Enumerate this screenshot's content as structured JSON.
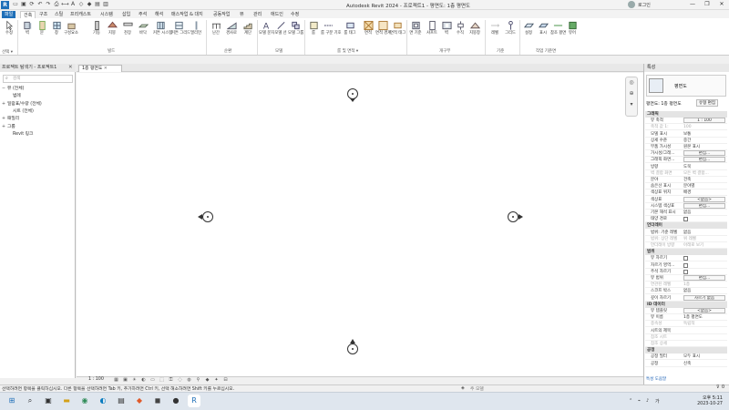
{
  "window": {
    "app_icon": "R",
    "title": "Autodesk Revit 2024 - 프로젝트1 - 평면도: 1층 평면도",
    "search_placeholder": "",
    "sign_in": "로그인",
    "controls": [
      "—",
      "❐",
      "✕"
    ]
  },
  "ribbon": {
    "tabs": [
      "파일",
      "건축",
      "구조",
      "스틸",
      "프리캐스트",
      "시스템",
      "삽입",
      "주석",
      "해석",
      "매스작업 & 대지",
      "공동작업",
      "뷰",
      "관리",
      "애드인",
      "수정"
    ],
    "active_tab": "건축",
    "modify_tool": "수정",
    "select_label": "선택 ▾",
    "groups": {
      "build": "빌드",
      "circulation": "순환",
      "model": "모델",
      "room_area": "룸 및 면적 ▾",
      "opening": "개구부",
      "datum": "기준",
      "work_plane": "작업 기준면"
    },
    "build_tools": [
      "벽",
      "문",
      "창",
      "구성요소",
      "기둥",
      "지붕",
      "천장",
      "바닥",
      "커튼 시스템",
      "커튼 그리드",
      "멀리언"
    ],
    "circulation_tools": [
      "난간",
      "경사로",
      "계단"
    ],
    "model_tools": [
      "모델 문자",
      "모델 선",
      "모델 그룹"
    ],
    "room_tools": [
      "룸",
      "룸 구분 기호",
      "룸 태그",
      "면적",
      "면적 경계",
      "면적 태그"
    ],
    "opening_tools": [
      "면 기준",
      "샤프트",
      "벽",
      "수직",
      "지붕창"
    ],
    "datum_tools": [
      "레벨",
      "그리드"
    ],
    "workplane_tools": [
      "설정",
      "표시",
      "참조 평면",
      "뷰어"
    ]
  },
  "project_browser": {
    "title": "프로젝트 탐색기 - 프로젝트1",
    "search_placeholder": "검색",
    "tree": [
      {
        "toggle": "−",
        "label": "뷰 (전체)",
        "indent": 0
      },
      {
        "toggle": "",
        "label": "범례",
        "indent": 1
      },
      {
        "toggle": "+",
        "label": "일람표/수량 (전체)",
        "indent": 0
      },
      {
        "toggle": "",
        "label": "시트 (전체)",
        "indent": 1
      },
      {
        "toggle": "+",
        "label": "패밀리",
        "indent": 0
      },
      {
        "toggle": "+",
        "label": "그룹",
        "indent": 0
      },
      {
        "toggle": "",
        "label": "Revit 링크",
        "indent": 1
      }
    ]
  },
  "view_tab": {
    "label": "1층 평면도"
  },
  "view_control": {
    "scale": "1 : 100"
  },
  "properties": {
    "title": "특성",
    "type_name": "평면도",
    "filter": "평면도: 1층 평면도",
    "edit_type": "유형 편집",
    "apply_help": "특성 도움말",
    "categories": [
      {
        "name": "그래픽",
        "rows": [
          {
            "n": "뷰 축척",
            "v": "1 : 100",
            "box": true
          },
          {
            "n": "축척 값 1:",
            "v": "100",
            "dim": true
          },
          {
            "n": "모델 표시",
            "v": "보통"
          },
          {
            "n": "상세 수준",
            "v": "중간"
          },
          {
            "n": "부품 가시성",
            "v": "원본 표시"
          },
          {
            "n": "가시성/그래...",
            "v": "편집...",
            "box": true
          },
          {
            "n": "그래픽 화면...",
            "v": "편집...",
            "box": true
          },
          {
            "n": "방향",
            "v": "도북"
          },
          {
            "n": "벽 결합 화면",
            "v": "모든 벽 결합...",
            "dim": true
          },
          {
            "n": "분야",
            "v": "건축"
          },
          {
            "n": "숨은선 표시",
            "v": "분야별"
          },
          {
            "n": "색상표 위치",
            "v": "배경"
          },
          {
            "n": "색상표",
            "v": "<없음>",
            "box": true
          },
          {
            "n": "시스템 색상표",
            "v": "편집...",
            "box": true
          },
          {
            "n": "기본 해석 표시",
            "v": "없음"
          },
          {
            "n": "태양 경로",
            "v": "",
            "check": true
          }
        ]
      },
      {
        "name": "언더레이",
        "rows": [
          {
            "n": "범위: 기준 레벨",
            "v": "없음"
          },
          {
            "n": "범위: 상단 레벨",
            "v": "위 레벨",
            "dim": true
          },
          {
            "n": "언더레이 방향",
            "v": "아래로 보기",
            "dim": true
          }
        ]
      },
      {
        "name": "범위",
        "rows": [
          {
            "n": "뷰 자르기",
            "v": "",
            "check": true
          },
          {
            "n": "자르기 영역...",
            "v": "",
            "check": true
          },
          {
            "n": "주석 자르기",
            "v": "",
            "check": true
          },
          {
            "n": "뷰 범위",
            "v": "편집...",
            "box": true
          },
          {
            "n": "연관된 레벨",
            "v": "1층",
            "dim": true
          },
          {
            "n": "스코프 박스",
            "v": "없음"
          },
          {
            "n": "깊이 자르기",
            "v": "자르기 없음",
            "box": true
          }
        ]
      },
      {
        "name": "ID 데이터",
        "rows": [
          {
            "n": "뷰 템플릿",
            "v": "<없음>",
            "box": true
          },
          {
            "n": "뷰 이름",
            "v": "1층 평면도"
          },
          {
            "n": "종속성",
            "v": "독립적",
            "dim": true
          },
          {
            "n": "시트의 제목",
            "v": ""
          },
          {
            "n": "참조 시트",
            "v": "",
            "dim": true
          },
          {
            "n": "참조 상세",
            "v": "",
            "dim": true
          }
        ]
      },
      {
        "name": "공정",
        "rows": [
          {
            "n": "공정 필터",
            "v": "모두 표시"
          },
          {
            "n": "공정",
            "v": "신축"
          }
        ]
      }
    ]
  },
  "status": {
    "hint": "선택하려면 항목을 클릭하십시오. 다른 항목을 선택하려면 Tab 키, 추가하려면 Ctrl 키, 선택 해소하려면 Shift 키를 누르십시오.",
    "model": "주 모델",
    "filter_count": "0"
  },
  "taskbar": {
    "time": "오후 5:11",
    "date": "2023-10-27",
    "lang": "가"
  },
  "colors": {
    "accent": "#1f6fb8",
    "canvas": "#ffffff",
    "taskbar": "#dfe6ee"
  }
}
